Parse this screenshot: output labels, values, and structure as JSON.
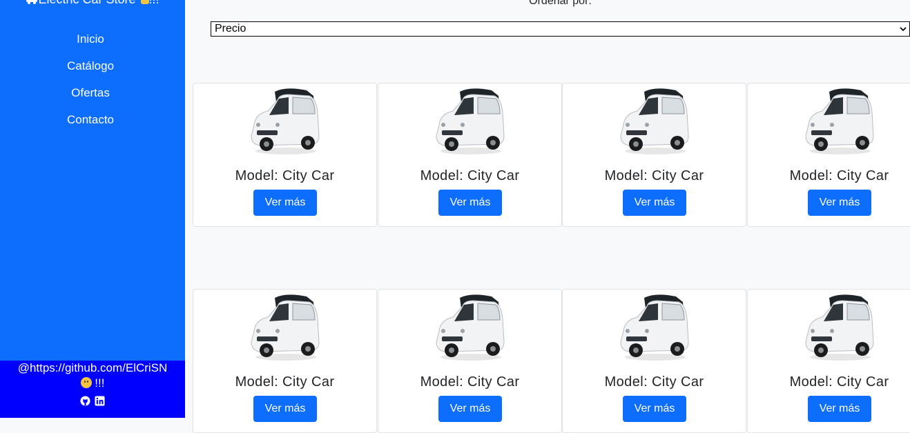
{
  "sidebar": {
    "brand": "Electric Car Store",
    "brand_suffix": "!!!",
    "nav": [
      "Inicio",
      "Catálogo",
      "Ofertas",
      "Contacto"
    ],
    "footer": {
      "text": "@https://github.com/ElCriSN",
      "suffix": "!!!",
      "icons": [
        "github-icon",
        "linkedin-icon"
      ]
    }
  },
  "filter": {
    "label": "Ordenar por:",
    "selected": "Precio"
  },
  "products": [
    {
      "model": "Model: City Car",
      "button": "Ver más"
    },
    {
      "model": "Model: City Car",
      "button": "Ver más"
    },
    {
      "model": "Model: City Car",
      "button": "Ver más"
    },
    {
      "model": "Model: City Car",
      "button": "Ver más"
    },
    {
      "model": "Model: City Car",
      "button": "Ver más"
    },
    {
      "model": "Model: City Car",
      "button": "Ver más"
    },
    {
      "model": "Model: City Car",
      "button": "Ver más"
    },
    {
      "model": "Model: City Car",
      "button": "Ver más"
    }
  ],
  "colors": {
    "sidebar": "#0d6efd",
    "footer": "#0000ff",
    "button": "#0d6efd",
    "background": "#f8f9fa"
  }
}
